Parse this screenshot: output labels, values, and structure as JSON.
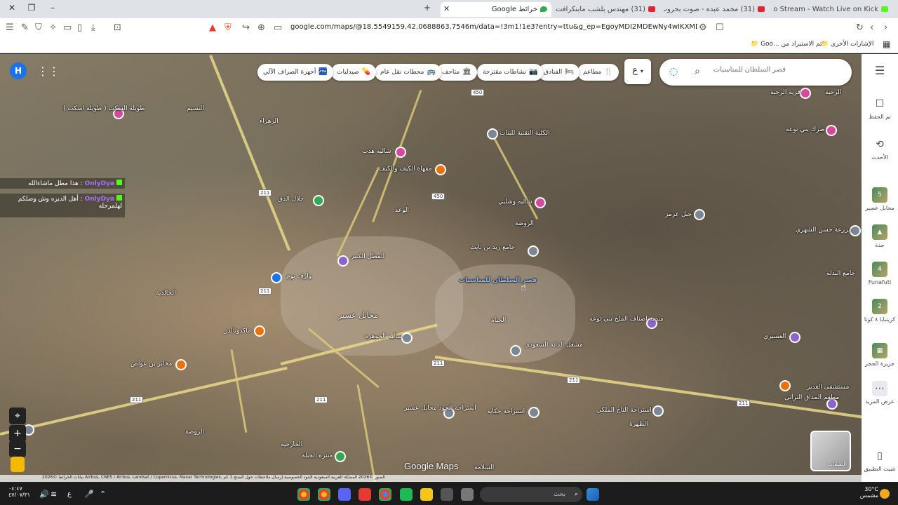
{
  "browser": {
    "tabs": [
      {
        "title": "Mojito Stream - Watch Live on Kick",
        "active": false,
        "fav": "kick"
      },
      {
        "title": "(31) محمد عبده - صوت بحروب - اليوم",
        "active": false,
        "fav": "youtube"
      },
      {
        "title": "(31) مهندس بلشب مابنكرافت - YouTube",
        "active": false,
        "fav": "youtube"
      },
      {
        "title": "خرائط Google",
        "active": true,
        "fav": "maps"
      }
    ],
    "new_tab": "+",
    "url": "google.com/maps/@18.5549159,42.0688863,7546m/data=!3m1!1e3?entry=ttu&g_ep=EgoyMDI2MDEwNy4wIKXMDSoKLDEwMDc5MjA3...",
    "bookmarks": [
      {
        "label": "الإشارات الأخرى"
      },
      {
        "label": "تم الاستيراد من ...Goo"
      }
    ]
  },
  "maps": {
    "search_placeholder": "قصر السلطان للمناسبات",
    "keyboard_label": "ع",
    "chips": [
      {
        "icon": "🍴",
        "label": "مطاعم"
      },
      {
        "icon": "🛏",
        "label": "الفنادق"
      },
      {
        "icon": "📷",
        "label": "نشاطات مقترحة"
      },
      {
        "icon": "🏛",
        "label": "متاحف"
      },
      {
        "icon": "🚌",
        "label": "محطات نقل عام"
      },
      {
        "icon": "💊",
        "label": "صيدليات"
      },
      {
        "icon": "🏧",
        "label": "أجهزة الصراف الآلي"
      }
    ],
    "avatar_letter": "H",
    "sidebar": [
      {
        "icon": "☐",
        "label": "تم الحفظ"
      },
      {
        "icon": "⟲",
        "label": "الأحدث"
      },
      {
        "icon": "5",
        "label": "محايل عسير"
      },
      {
        "icon": "▲",
        "label": "جدة"
      },
      {
        "icon": "4",
        "label": "Funafuti"
      },
      {
        "icon": "2",
        "label": "كريتبابا ٨ كوتا"
      },
      {
        "icon": "▦",
        "label": "جزيرة الحجر"
      },
      {
        "icon": "⋯",
        "label": "عرض المزيد"
      },
      {
        "icon": "▯",
        "label": "تثبيت التطبيق"
      }
    ],
    "layers_label": "الطبقات",
    "logo": "Google Maps",
    "attribution": "بيانات الخرائط ©2026 Airbus, CNES / Airbus, Landsat / Copernicus, Maxar Technologies, الصور ©2026   المملكة العربية السعودية   البنود   الخصوصية   إرسال ملاحظات حول المنتج   1 كم",
    "places": [
      {
        "label": "قصر السلطان للمناسبات",
        "style": "blue"
      },
      {
        "label": "محايل عسير",
        "style": "big"
      },
      {
        "label": "الكلية التقنية للبنات"
      },
      {
        "label": "شاليه هدب"
      },
      {
        "label": "مقهاة الكيف والكيف"
      },
      {
        "label": "شاليه وشلبي"
      },
      {
        "label": "جامع زيد بن ثابت"
      },
      {
        "label": "جبل عرمز"
      },
      {
        "label": "مزرعة حسن الشهري"
      },
      {
        "label": "ضرك بني توعه"
      },
      {
        "label": "قرية الرحبة"
      },
      {
        "label": "الرحبة"
      },
      {
        "label": "منصة اصناف الملح بني توعه"
      },
      {
        "label": "العسيري"
      },
      {
        "label": "جامع البدلة"
      },
      {
        "label": "طويلة السكب ( طويلة اسكب )"
      },
      {
        "label": "النسيم"
      },
      {
        "label": "الزهراء"
      },
      {
        "label": "الوعد"
      },
      {
        "label": "الخالدية"
      },
      {
        "label": "ماكدونالدز"
      },
      {
        "label": "مخابز بن عواض"
      },
      {
        "label": "استراحة الجود محايل عسير"
      },
      {
        "label": "استراحة حكاية"
      },
      {
        "label": "استراحة التاج الملكي"
      },
      {
        "label": "الظهرة"
      },
      {
        "label": "الروضة"
      },
      {
        "label": "الخارجية"
      },
      {
        "label": "منتزه الجبلة"
      },
      {
        "label": "السلامة"
      },
      {
        "label": "مستشفى الغدير"
      },
      {
        "label": "المطل الكبير"
      },
      {
        "label": "شالية الجوهرة"
      },
      {
        "label": "مشغل الدانة السعودي"
      },
      {
        "label": "مطعم المذاق التراثي"
      },
      {
        "label": "الحياة"
      },
      {
        "label": "الروضة"
      },
      {
        "label": "وارف نوم"
      },
      {
        "label": "حلال الدق"
      }
    ],
    "routes": [
      "450",
      "450",
      "211",
      "211",
      "211",
      "211",
      "211",
      "211",
      "211"
    ]
  },
  "stream_chat": [
    {
      "user": "OnlyDya",
      "text": "هذا مطل ماشاءالله"
    },
    {
      "user": "OnlyDya",
      "text": "أهل الديره وش وصلكم لهلمرحله"
    }
  ],
  "taskbar": {
    "search_label": "بحث",
    "weather_temp": "30°C",
    "weather_text": "مشمس",
    "time": "٠٤:٤٧",
    "date": "٤٧/٠٧/٣١",
    "lang": "ع"
  }
}
